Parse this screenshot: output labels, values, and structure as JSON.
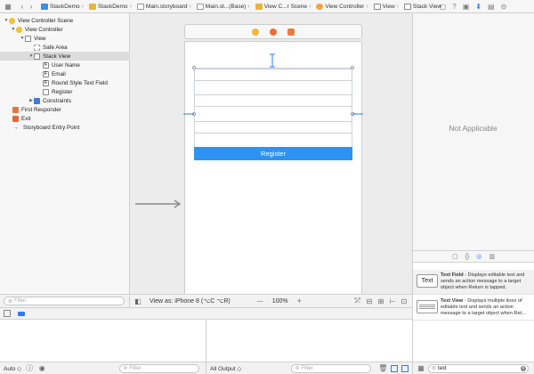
{
  "breadcrumbs": [
    {
      "label": "StackDemo",
      "icon": "project-icon"
    },
    {
      "label": "StackDemo",
      "icon": "folder-icon"
    },
    {
      "label": "Main.storyboard",
      "icon": "storyboard-file-icon"
    },
    {
      "label": "Main.st...(Base)",
      "icon": "storyboard-file-icon"
    },
    {
      "label": "View C...r Scene",
      "icon": "scene-icon"
    },
    {
      "label": "View Controller",
      "icon": "view-controller-icon"
    },
    {
      "label": "View",
      "icon": "view-icon"
    },
    {
      "label": "Stack View",
      "icon": "stack-view-icon"
    }
  ],
  "outline": {
    "items": [
      {
        "label": "View Controller Scene",
        "depth": 0,
        "expanded": true,
        "icon": "scene-icon"
      },
      {
        "label": "View Controller",
        "depth": 1,
        "expanded": true,
        "icon": "view-controller-icon"
      },
      {
        "label": "View",
        "depth": 2,
        "expanded": true,
        "icon": "view-icon"
      },
      {
        "label": "Safe Area",
        "depth": 3,
        "icon": "safe-area-icon"
      },
      {
        "label": "Stack View",
        "depth": 3,
        "expanded": true,
        "selected": true,
        "icon": "stack-view-icon"
      },
      {
        "label": "User Name",
        "depth": 4,
        "icon": "text-field-icon"
      },
      {
        "label": "Email",
        "depth": 4,
        "icon": "text-field-icon"
      },
      {
        "label": "Round Style Text Field",
        "depth": 4,
        "icon": "text-field-icon"
      },
      {
        "label": "Register",
        "depth": 4,
        "icon": "button-icon"
      },
      {
        "label": "Constraints",
        "depth": 3,
        "expanded": false,
        "icon": "constraints-icon"
      },
      {
        "label": "First Responder",
        "depth": 1,
        "icon": "first-responder-icon"
      },
      {
        "label": "Exit",
        "depth": 1,
        "icon": "exit-icon"
      },
      {
        "label": "Storyboard Entry Point",
        "depth": 1,
        "icon": "entry-point-icon"
      }
    ],
    "filter_placeholder": "Filter"
  },
  "canvas": {
    "register_label": "Register",
    "view_as": "View as: iPhone 8 (⌥C ⌥R)",
    "zoom": "100%",
    "zoom_minus": "—",
    "zoom_plus": "+"
  },
  "inspector": {
    "not_applicable": "Not Applicable"
  },
  "library": {
    "items": [
      {
        "thumb": "Text",
        "name": "Text Field",
        "desc": " - Displays editable text and sends an action message to a target object when Return is tapped."
      },
      {
        "thumb": "",
        "name": "Text View",
        "desc": " - Displays multiple lines of editable text and sends an action message to a target object when Ret..."
      }
    ],
    "filter_value": "text"
  },
  "debug": {
    "auto_label": "Auto ◇",
    "all_output_label": "All Output ◇",
    "filter_placeholder": "Filter"
  },
  "colors": {
    "accent": "#2d7cf6",
    "register_button": "#2d92f4"
  }
}
